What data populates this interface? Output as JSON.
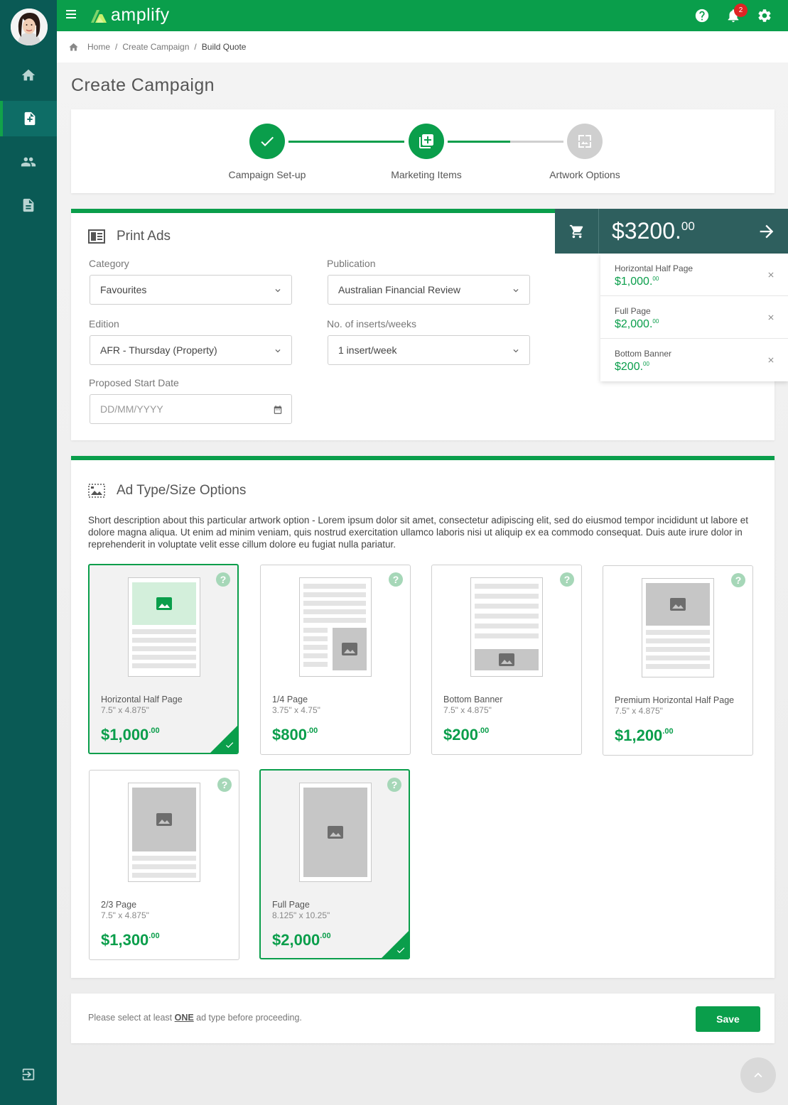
{
  "app": {
    "brand": "amplify",
    "notification_count": "2",
    "accent_color": "#0a9e4b",
    "sidebar_color": "#0a5a55"
  },
  "sidebar": {
    "items": [
      {
        "name": "home",
        "icon": "home-icon"
      },
      {
        "name": "create-campaign",
        "icon": "add-document-icon",
        "active": true
      },
      {
        "name": "users",
        "icon": "people-icon"
      },
      {
        "name": "documents",
        "icon": "document-icon"
      }
    ],
    "logout_icon": "logout-icon"
  },
  "breadcrumb": {
    "home": "Home",
    "create_campaign": "Create Campaign",
    "current": "Build Quote"
  },
  "page": {
    "title": "Create Campaign"
  },
  "stepper": {
    "steps": [
      {
        "label": "Campaign Set-up",
        "state": "done"
      },
      {
        "label": "Marketing Items",
        "state": "current"
      },
      {
        "label": "Artwork Options",
        "state": "pending"
      }
    ]
  },
  "print_ads": {
    "title": "Print Ads",
    "category_label": "Category",
    "category_value": "Favourites",
    "publication_label": "Publication",
    "publication_value": "Australian Financial Review",
    "edition_label": "Edition",
    "edition_value": "AFR - Thursday (Property)",
    "inserts_label": "No. of inserts/weeks",
    "inserts_value": "1 insert/week",
    "start_date_label": "Proposed Start Date",
    "start_date_placeholder": "DD/MM/YYYY"
  },
  "cart": {
    "total_main": "$3200.",
    "total_cents": "00",
    "items": [
      {
        "name": "Horizontal Half Page",
        "price": "$1,000.",
        "cents": "00"
      },
      {
        "name": "Full Page",
        "price": "$2,000.",
        "cents": "00"
      },
      {
        "name": "Bottom Banner",
        "price": "$200.",
        "cents": "00"
      }
    ]
  },
  "ad_types": {
    "title": "Ad Type/Size Options",
    "description": "Short description about this particular artwork option - Lorem ipsum dolor sit amet, consectetur adipiscing elit, sed do eiusmod tempor incididunt ut labore et dolore magna aliqua. Ut enim ad minim veniam, quis nostrud exercitation ullamco laboris nisi ut aliquip ex ea commodo consequat. Duis aute irure dolor in reprehenderit in voluptate velit esse cillum dolore eu fugiat nulla pariatur.",
    "help_glyph": "?",
    "options": [
      {
        "name": "Horizontal Half Page",
        "dims": "7.5\" x 4.875\"",
        "price": "$1,000",
        "cents": ".00",
        "selected": true
      },
      {
        "name": "1/4 Page",
        "dims": "3.75\" x 4.75\"",
        "price": "$800",
        "cents": ".00",
        "selected": false
      },
      {
        "name": "Bottom Banner",
        "dims": "7.5\" x 4.875\"",
        "price": "$200",
        "cents": ".00",
        "selected": false
      },
      {
        "name": "Premium Horizontal Half Page",
        "dims": "7.5\" x 4.875\"",
        "price": "$1,200",
        "cents": ".00",
        "selected": false
      },
      {
        "name": "2/3 Page",
        "dims": "7.5\" x 4.875\"",
        "price": "$1,300",
        "cents": ".00",
        "selected": false
      },
      {
        "name": "Full Page",
        "dims": "8.125\" x 10.25\"",
        "price": "$2,000",
        "cents": ".00",
        "selected": true
      }
    ]
  },
  "footer": {
    "note_prefix": "Please select at least ",
    "note_emphasis": "ONE",
    "note_suffix": " ad type before proceeding.",
    "save_label": "Save"
  }
}
